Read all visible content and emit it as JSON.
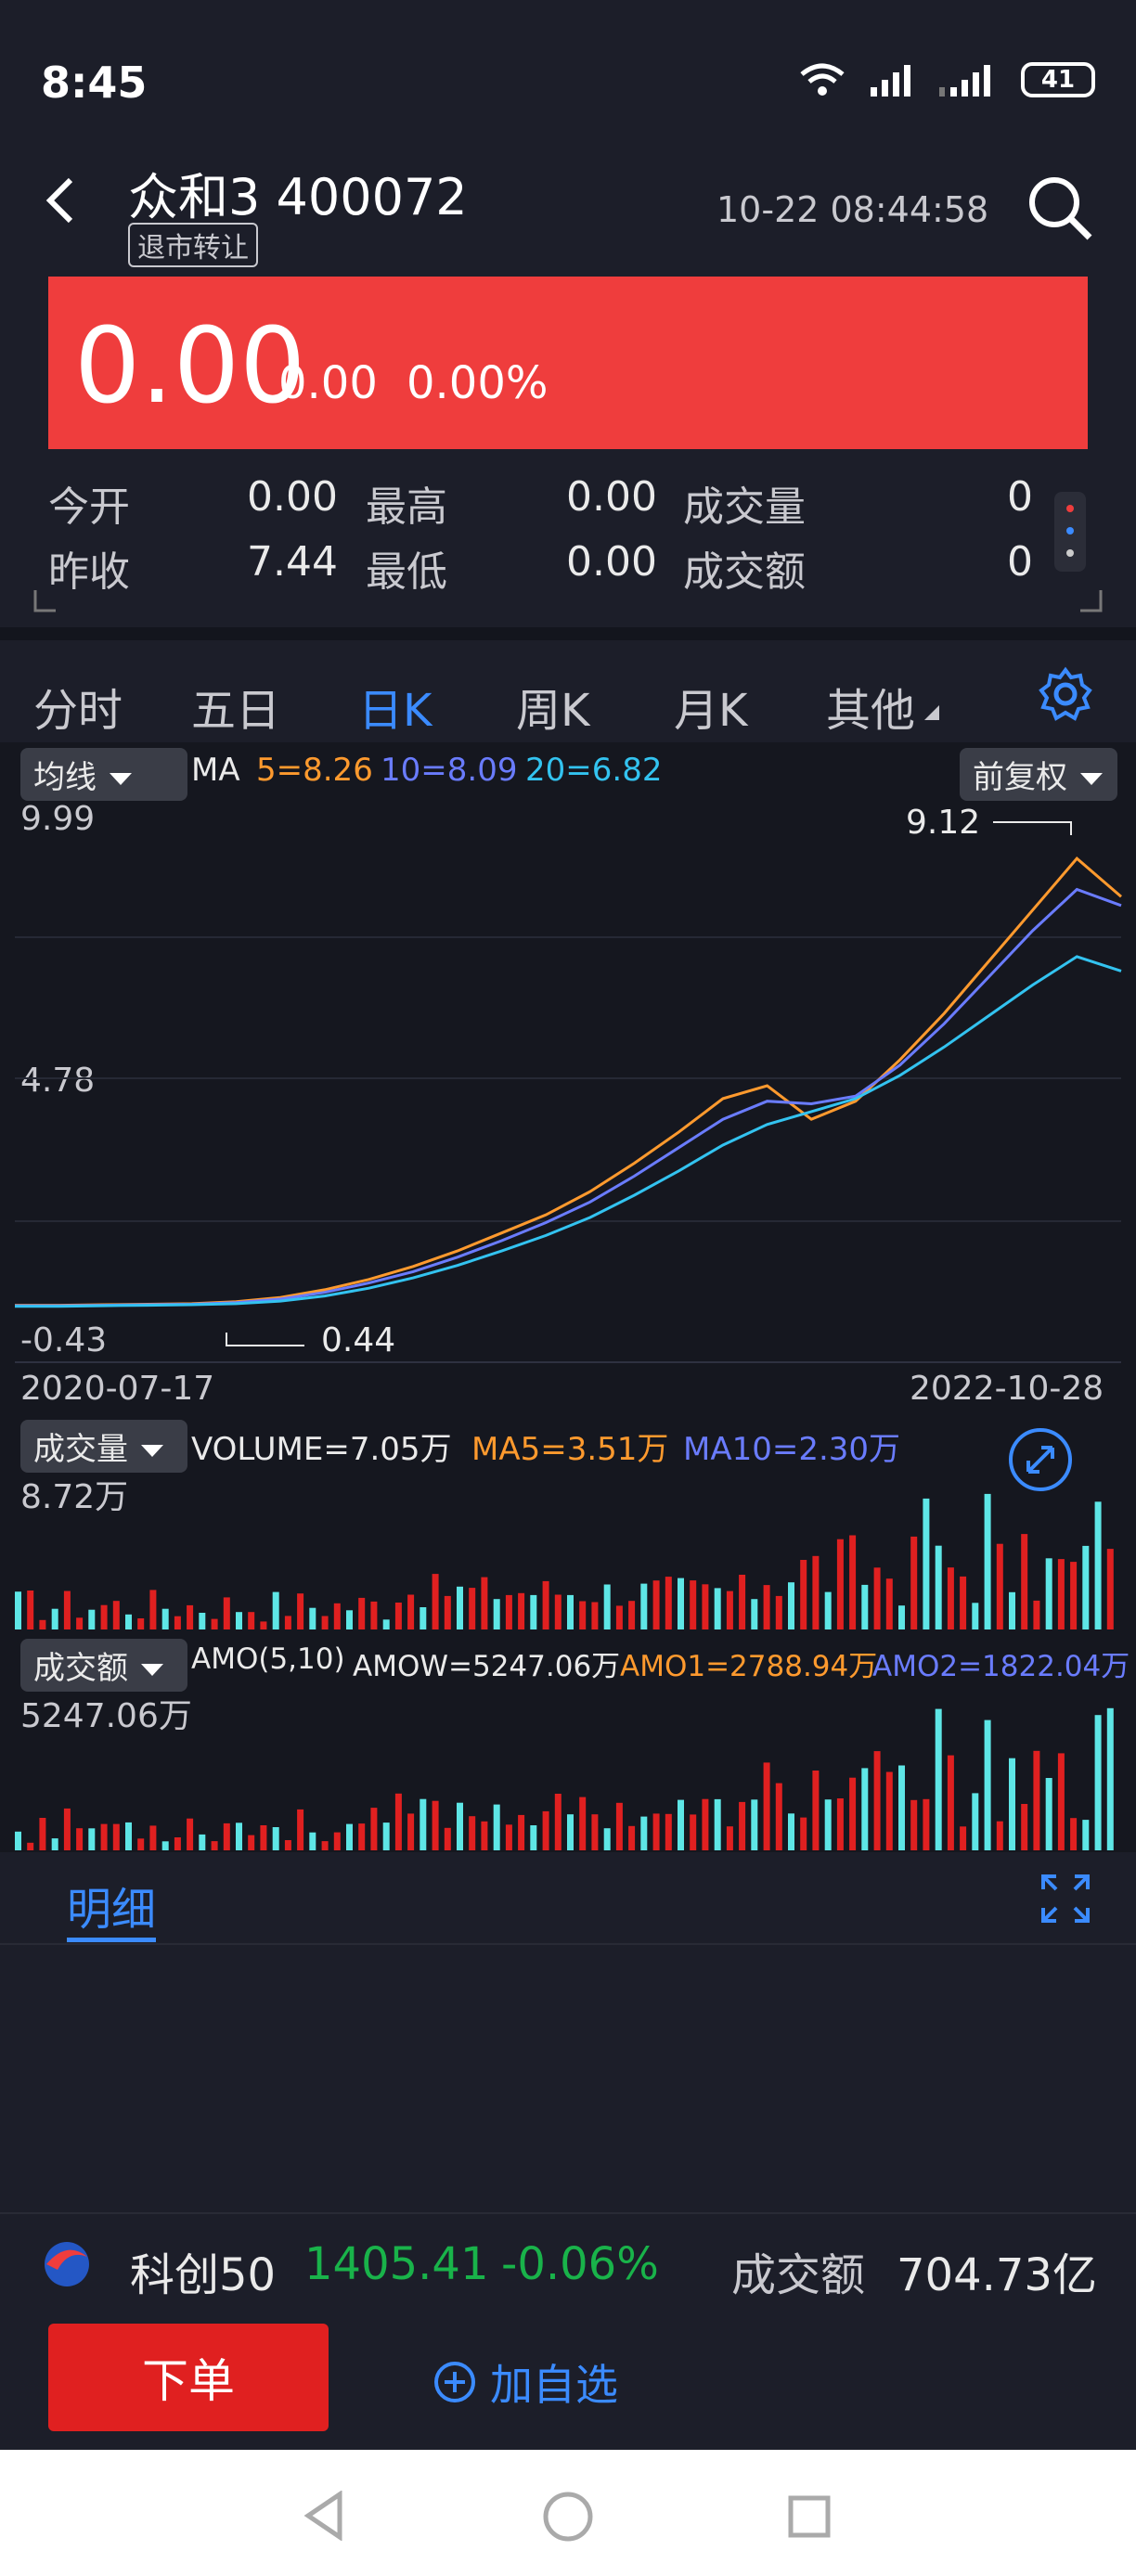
{
  "status": {
    "time": "8:45",
    "battery": "41"
  },
  "header": {
    "title": "众和3 400072",
    "tag": "退市转让",
    "datetime": "10-22 08:44:58"
  },
  "quote": {
    "price": "0.00",
    "change": "0.00",
    "change_pct": "0.00%"
  },
  "stats": {
    "open_label": "今开",
    "open": "0.00",
    "high_label": "最高",
    "high": "0.00",
    "vol_label": "成交量",
    "vol": "0",
    "prev_label": "昨收",
    "prev": "7.44",
    "low_label": "最低",
    "low": "0.00",
    "amt_label": "成交额",
    "amt": "0"
  },
  "tabs": [
    "分时",
    "五日",
    "日K",
    "周K",
    "月K",
    "其他"
  ],
  "kline": {
    "ma_select": "均线",
    "ma_label": "MA",
    "ma5": "5=8.26",
    "ma10": "10=8.09",
    "ma20": "20=6.82",
    "adjust": "前复权",
    "top": "9.99",
    "mid": "4.78",
    "bottom": "-0.43",
    "high_mark": "9.12",
    "low_mark": "0.44",
    "date_start": "2020-07-17",
    "date_end": "2022-10-28"
  },
  "volume": {
    "select": "成交量",
    "label": "VOLUME=7.05万",
    "ma5": "MA5=3.51万",
    "ma10": "MA10=2.30万",
    "max": "8.72万"
  },
  "amount": {
    "select": "成交额",
    "label": "AMO(5,10)",
    "amow": "AMOW=5247.06万",
    "amo1": "AMO1=2788.94万",
    "amo2": "AMO2=1822.04万",
    "max": "5247.06万"
  },
  "detail": {
    "tab": "明细"
  },
  "index": {
    "name": "科创50",
    "value": "1405.41",
    "change": "-0.06%",
    "amt_label": "成交额",
    "amt": "704.73亿"
  },
  "actions": {
    "order": "下单",
    "add_fav": "加自选"
  },
  "colors": {
    "up": "#e02020",
    "down": "#5ee6e6",
    "ma5": "#ff9a2e",
    "ma10": "#6a7cff",
    "ma20": "#33c3f0",
    "accent": "#3b8bff"
  },
  "chart_data": {
    "type": "line",
    "series": [
      {
        "name": "MA5",
        "values": [
          0.35,
          0.35,
          0.36,
          0.37,
          0.38,
          0.42,
          0.5,
          0.65,
          0.85,
          1.1,
          1.4,
          1.75,
          2.1,
          2.55,
          3.1,
          3.7,
          4.35,
          4.6,
          3.95,
          4.3,
          5.1,
          6.0,
          7.0,
          8.0,
          9.0,
          8.26
        ]
      },
      {
        "name": "MA10",
        "values": [
          0.34,
          0.34,
          0.35,
          0.36,
          0.37,
          0.4,
          0.47,
          0.6,
          0.78,
          1.0,
          1.28,
          1.6,
          1.95,
          2.35,
          2.85,
          3.4,
          3.95,
          4.3,
          4.25,
          4.4,
          5.0,
          5.8,
          6.7,
          7.6,
          8.4,
          8.09
        ]
      },
      {
        "name": "MA20",
        "values": [
          0.33,
          0.33,
          0.34,
          0.35,
          0.36,
          0.38,
          0.43,
          0.53,
          0.68,
          0.88,
          1.12,
          1.4,
          1.7,
          2.05,
          2.48,
          2.95,
          3.45,
          3.85,
          4.1,
          4.35,
          4.8,
          5.35,
          5.95,
          6.55,
          7.1,
          6.82
        ]
      }
    ],
    "ylim": [
      -0.43,
      9.99
    ]
  }
}
